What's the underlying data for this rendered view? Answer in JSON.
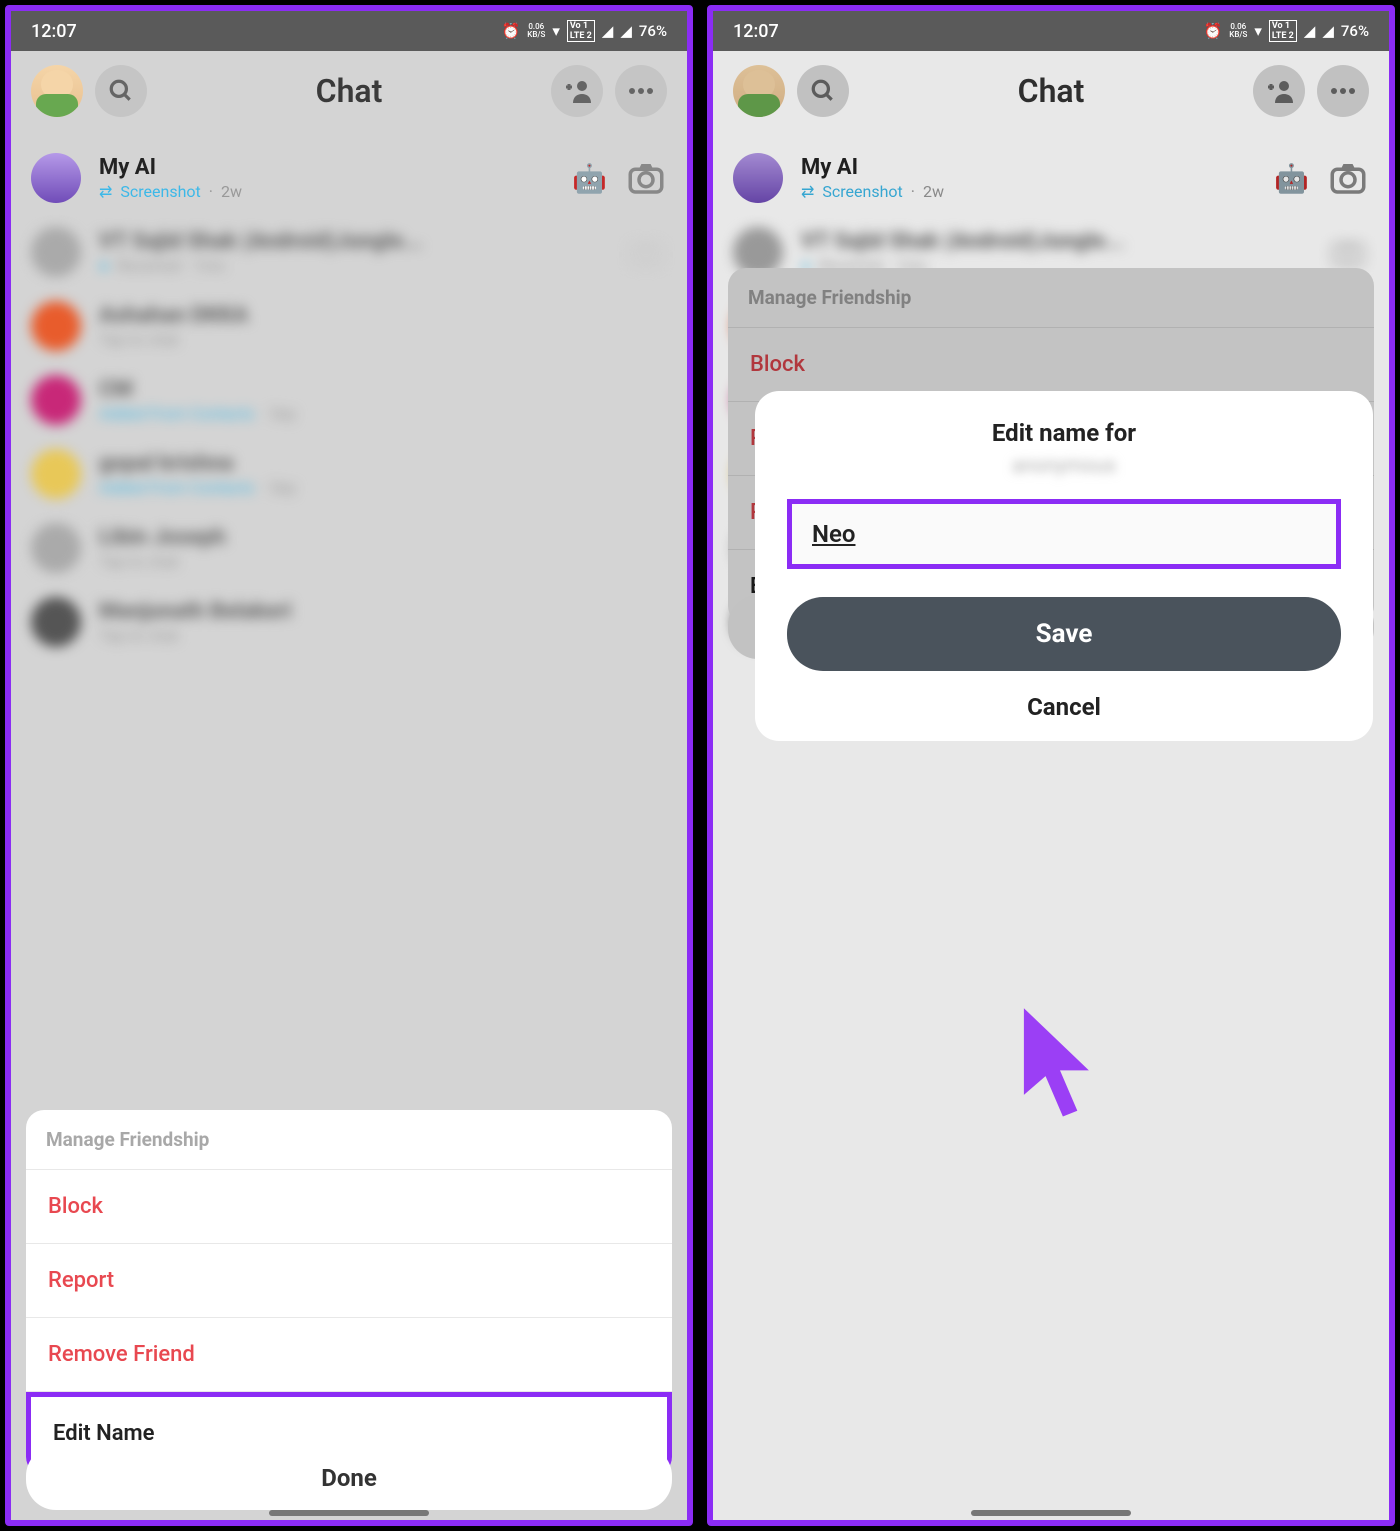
{
  "status": {
    "time": "12:07",
    "net_speed_top": "0.06",
    "net_speed_bot": "KB/S",
    "lte_top": "Vo 1",
    "lte_bot": "LTE 2",
    "battery": "76%"
  },
  "header": {
    "title": "Chat"
  },
  "chats": {
    "myai": {
      "name": "My AI",
      "sub_action": "Screenshot",
      "sub_time": "2w"
    }
  },
  "sheet": {
    "title": "Manage Friendship",
    "block": "Block",
    "report": "Report",
    "remove": "Remove Friend",
    "edit": "Edit Name"
  },
  "done": "Done",
  "modal": {
    "title": "Edit name for",
    "subtitle": "anonymous",
    "value": "Neo",
    "save": "Save",
    "cancel": "Cancel"
  }
}
